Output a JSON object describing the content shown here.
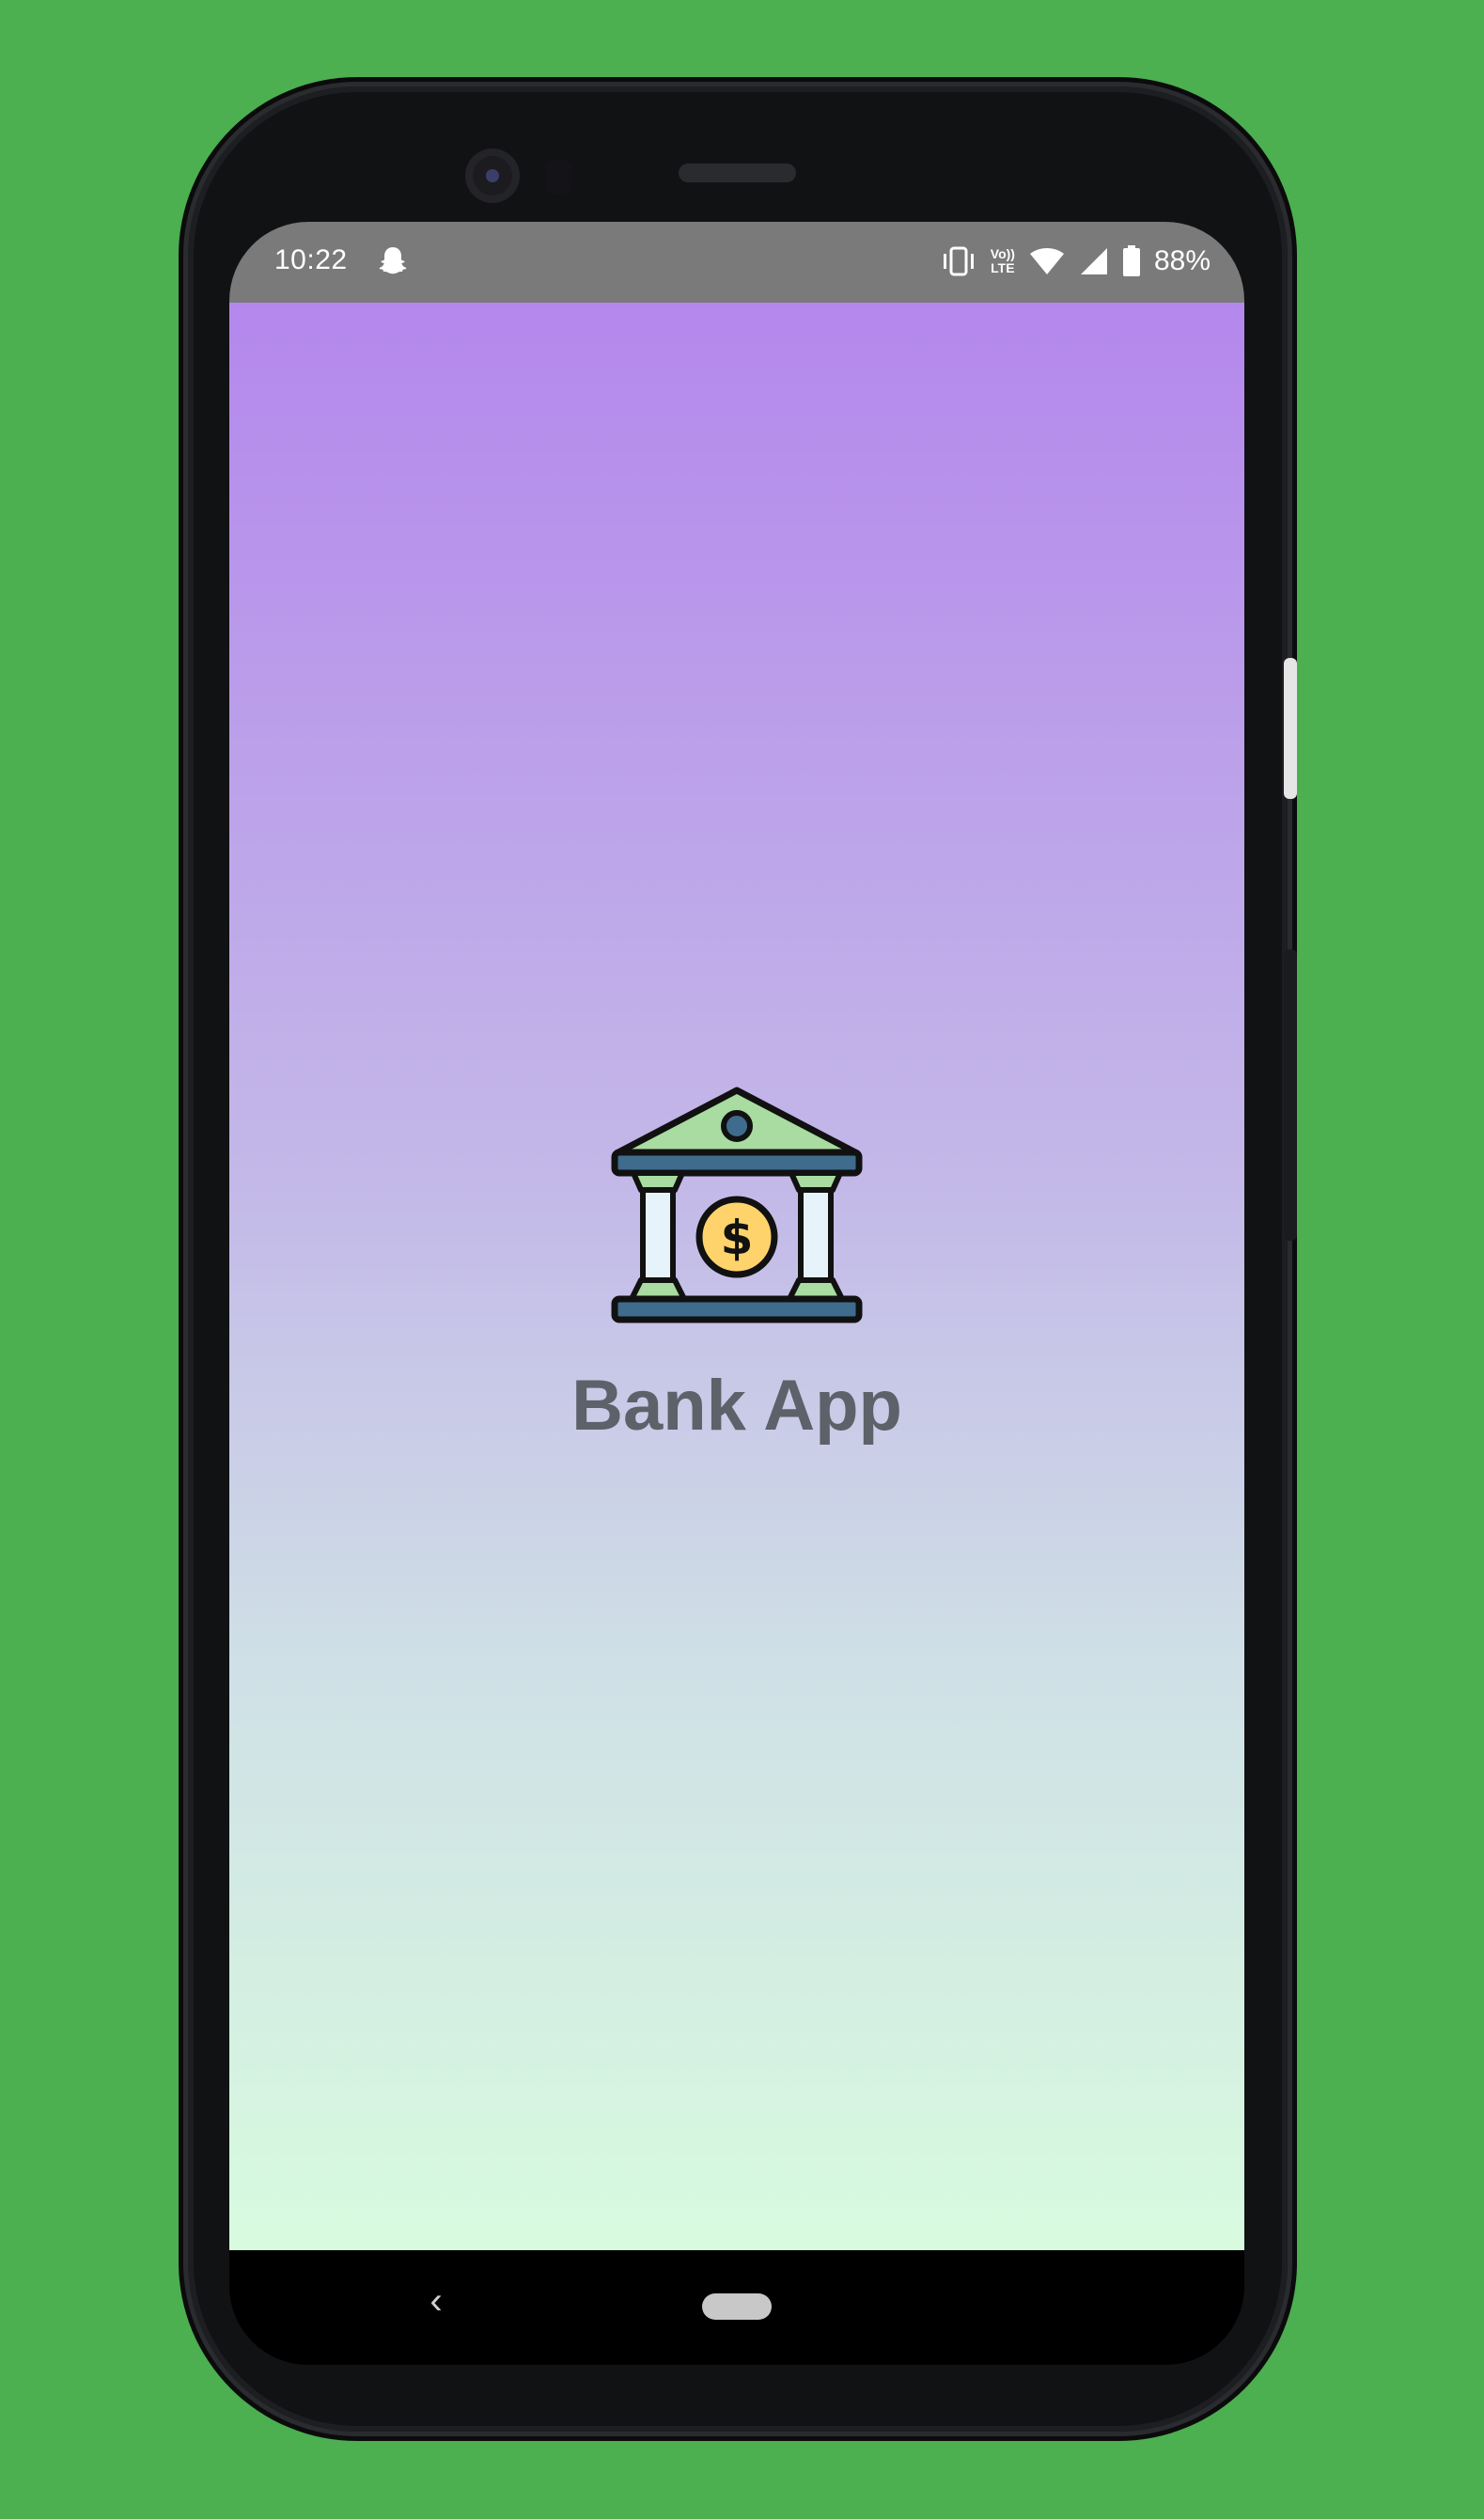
{
  "status_bar": {
    "time": "10:22",
    "notification_icon": "snapchat-ghost-icon",
    "icons": [
      "vibrate-icon",
      "volte-lte-icon",
      "wifi-icon",
      "cell-signal-icon",
      "battery-icon"
    ],
    "volte_line1": "Vo))",
    "volte_line2": "LTE",
    "battery_percent": "88%"
  },
  "app": {
    "logo_icon": "bank-icon",
    "title": "Bank App",
    "gradient_top": "#b487ec",
    "gradient_bottom": "#d8fbdf"
  },
  "nav_bar": {
    "back_icon": "chevron-left-icon",
    "home_icon": "home-pill-icon",
    "back_glyph": "‹"
  },
  "colors": {
    "background": "#4caf50",
    "title_text": "#5d6169",
    "status_bar": "#7a7a7a"
  }
}
